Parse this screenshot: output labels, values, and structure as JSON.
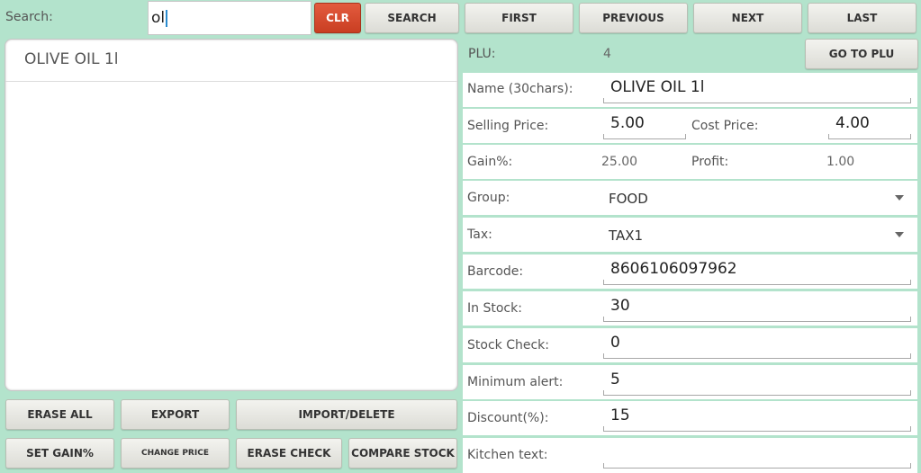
{
  "search": {
    "label": "Search:",
    "value": "ol"
  },
  "top_buttons": {
    "clr": "CLR",
    "search": "SEARCH",
    "first": "FIRST",
    "previous": "PREVIOUS",
    "next": "NEXT",
    "last": "LAST"
  },
  "list": {
    "items": [
      "OLIVE OIL 1l"
    ]
  },
  "bottom_buttons": {
    "erase_all": "ERASE ALL",
    "export": "EXPORT",
    "import_delete": "IMPORT/DELETE",
    "set_gain": "SET GAIN%",
    "change_price": "CHANGE PRICE",
    "erase_check": "ERASE CHECK",
    "compare_stock": "COMPARE STOCK"
  },
  "form": {
    "plu_label": "PLU:",
    "plu_value": "4",
    "go_to_plu": "GO TO PLU",
    "name_label": "Name (30chars):",
    "name_value": "OLIVE OIL 1l",
    "selling_price_label": "Selling Price:",
    "selling_price_value": "5.00",
    "cost_price_label": "Cost Price:",
    "cost_price_value": "4.00",
    "gain_label": "Gain%:",
    "gain_value": "25.00",
    "profit_label": "Profit:",
    "profit_value": "1.00",
    "group_label": "Group:",
    "group_value": "FOOD",
    "tax_label": "Tax:",
    "tax_value": "TAX1",
    "barcode_label": "Barcode:",
    "barcode_value": "8606106097962",
    "in_stock_label": "In Stock:",
    "in_stock_value": "30",
    "stock_check_label": "Stock Check:",
    "stock_check_value": "0",
    "min_alert_label": "Minimum alert:",
    "min_alert_value": "5",
    "discount_label": "Discount(%):",
    "discount_value": "15",
    "kitchen_label": "Kitchen text:",
    "kitchen_value": ""
  },
  "colors": {
    "background": "#b3e3cc",
    "accent_red": "#d2472b",
    "caret": "#2b8ccf"
  },
  "icons": {
    "dropdown": "triangle-down"
  }
}
